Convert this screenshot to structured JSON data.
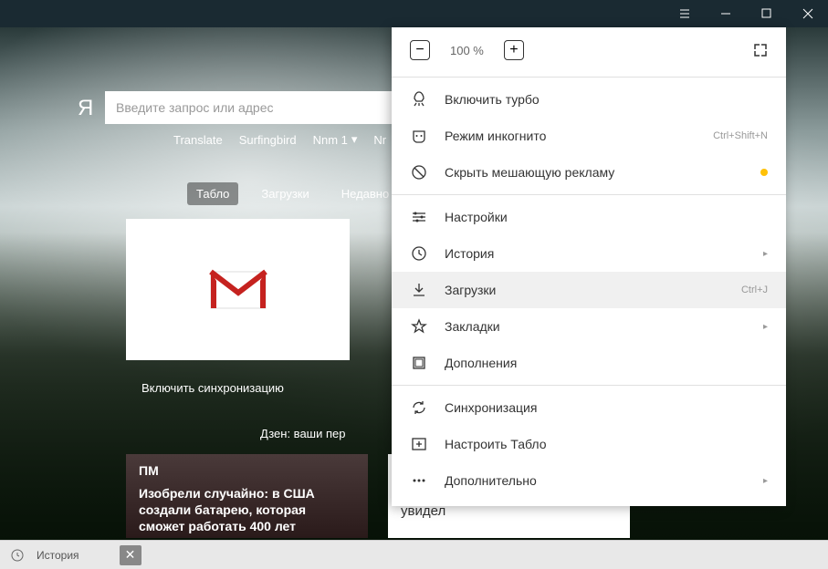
{
  "titlebar": {
    "menu": "menu",
    "minimize": "minimize",
    "maximize": "maximize",
    "close": "close"
  },
  "search": {
    "placeholder": "Введите запрос или адрес",
    "logo": "Я"
  },
  "nav": {
    "translate": "Translate",
    "surfingbird": "Surfingbird",
    "nnm": "Nnm 1",
    "nr": "Nr"
  },
  "tabs": {
    "tablo": "Табло",
    "downloads": "Загрузки",
    "recent": "Недавно за"
  },
  "tile": {
    "name": "Gmail"
  },
  "sync_label": "Включить синхронизацию",
  "zen_label": "Дзен: ваши пер",
  "news": {
    "left": {
      "source": "ПМ",
      "title": "Изобрели случайно: в США создали батарею, которая сможет работать 400 лет"
    },
    "right": {
      "title": "Этот парень попал в первый класс самолета. И вот что он там увидел"
    }
  },
  "menu": {
    "zoom": {
      "value": "100 %"
    },
    "turbo": "Включить турбо",
    "incognito": "Режим инкогнито",
    "incognito_shortcut": "Ctrl+Shift+N",
    "adblock": "Скрыть мешающую рекламу",
    "settings": "Настройки",
    "history": "История",
    "downloads": "Загрузки",
    "downloads_shortcut": "Ctrl+J",
    "bookmarks": "Закладки",
    "addons": "Дополнения",
    "sync": "Синхронизация",
    "customize_tablo": "Настроить Табло",
    "more": "Дополнительно"
  },
  "bottombar": {
    "label": "История"
  }
}
